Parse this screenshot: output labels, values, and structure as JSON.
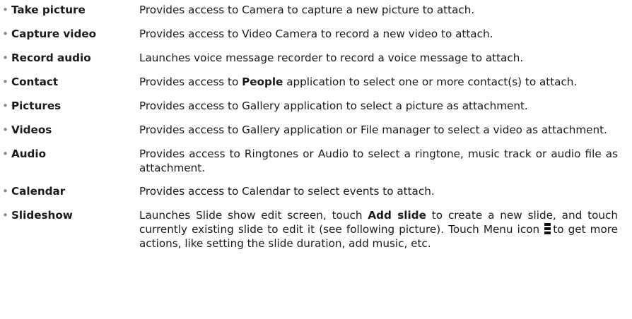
{
  "items": [
    {
      "term": "Take picture",
      "desc": "Provides access to Camera to capture a new picture to attach."
    },
    {
      "term": "Capture video",
      "desc": "Provides access to Video Camera to record a new video to attach."
    },
    {
      "term": "Record audio",
      "desc": "Launches voice message recorder to record a voice message to attach."
    },
    {
      "term": "Contact",
      "desc_pre": "Provides access to",
      "desc_bold": "People",
      "desc_post": "application to select one or more contact(s) to attach."
    },
    {
      "term": "Pictures",
      "desc": "Provides access to Gallery application to select a picture as attachment."
    },
    {
      "term": "Videos",
      "desc": "Provides access to Gallery application or File manager to select a video as attachment."
    },
    {
      "term": "Audio",
      "desc": "Provides access to Ringtones or Audio to select a ringtone, music track or audio file as attachment."
    },
    {
      "term": "Calendar",
      "desc": "Provides access to Calendar to select events to attach."
    },
    {
      "term": "Slideshow",
      "desc_pre": "Launches Slide show edit screen, touch",
      "desc_bold": "Add slide",
      "desc_mid": "to create a new slide, and touch currently existing slide to edit it (see following picture). Touch Menu icon",
      "desc_post": "to get more actions, like setting the slide duration, add music, etc."
    }
  ],
  "bullet_glyph": "•",
  "icons": {
    "menu": "menu-icon"
  }
}
